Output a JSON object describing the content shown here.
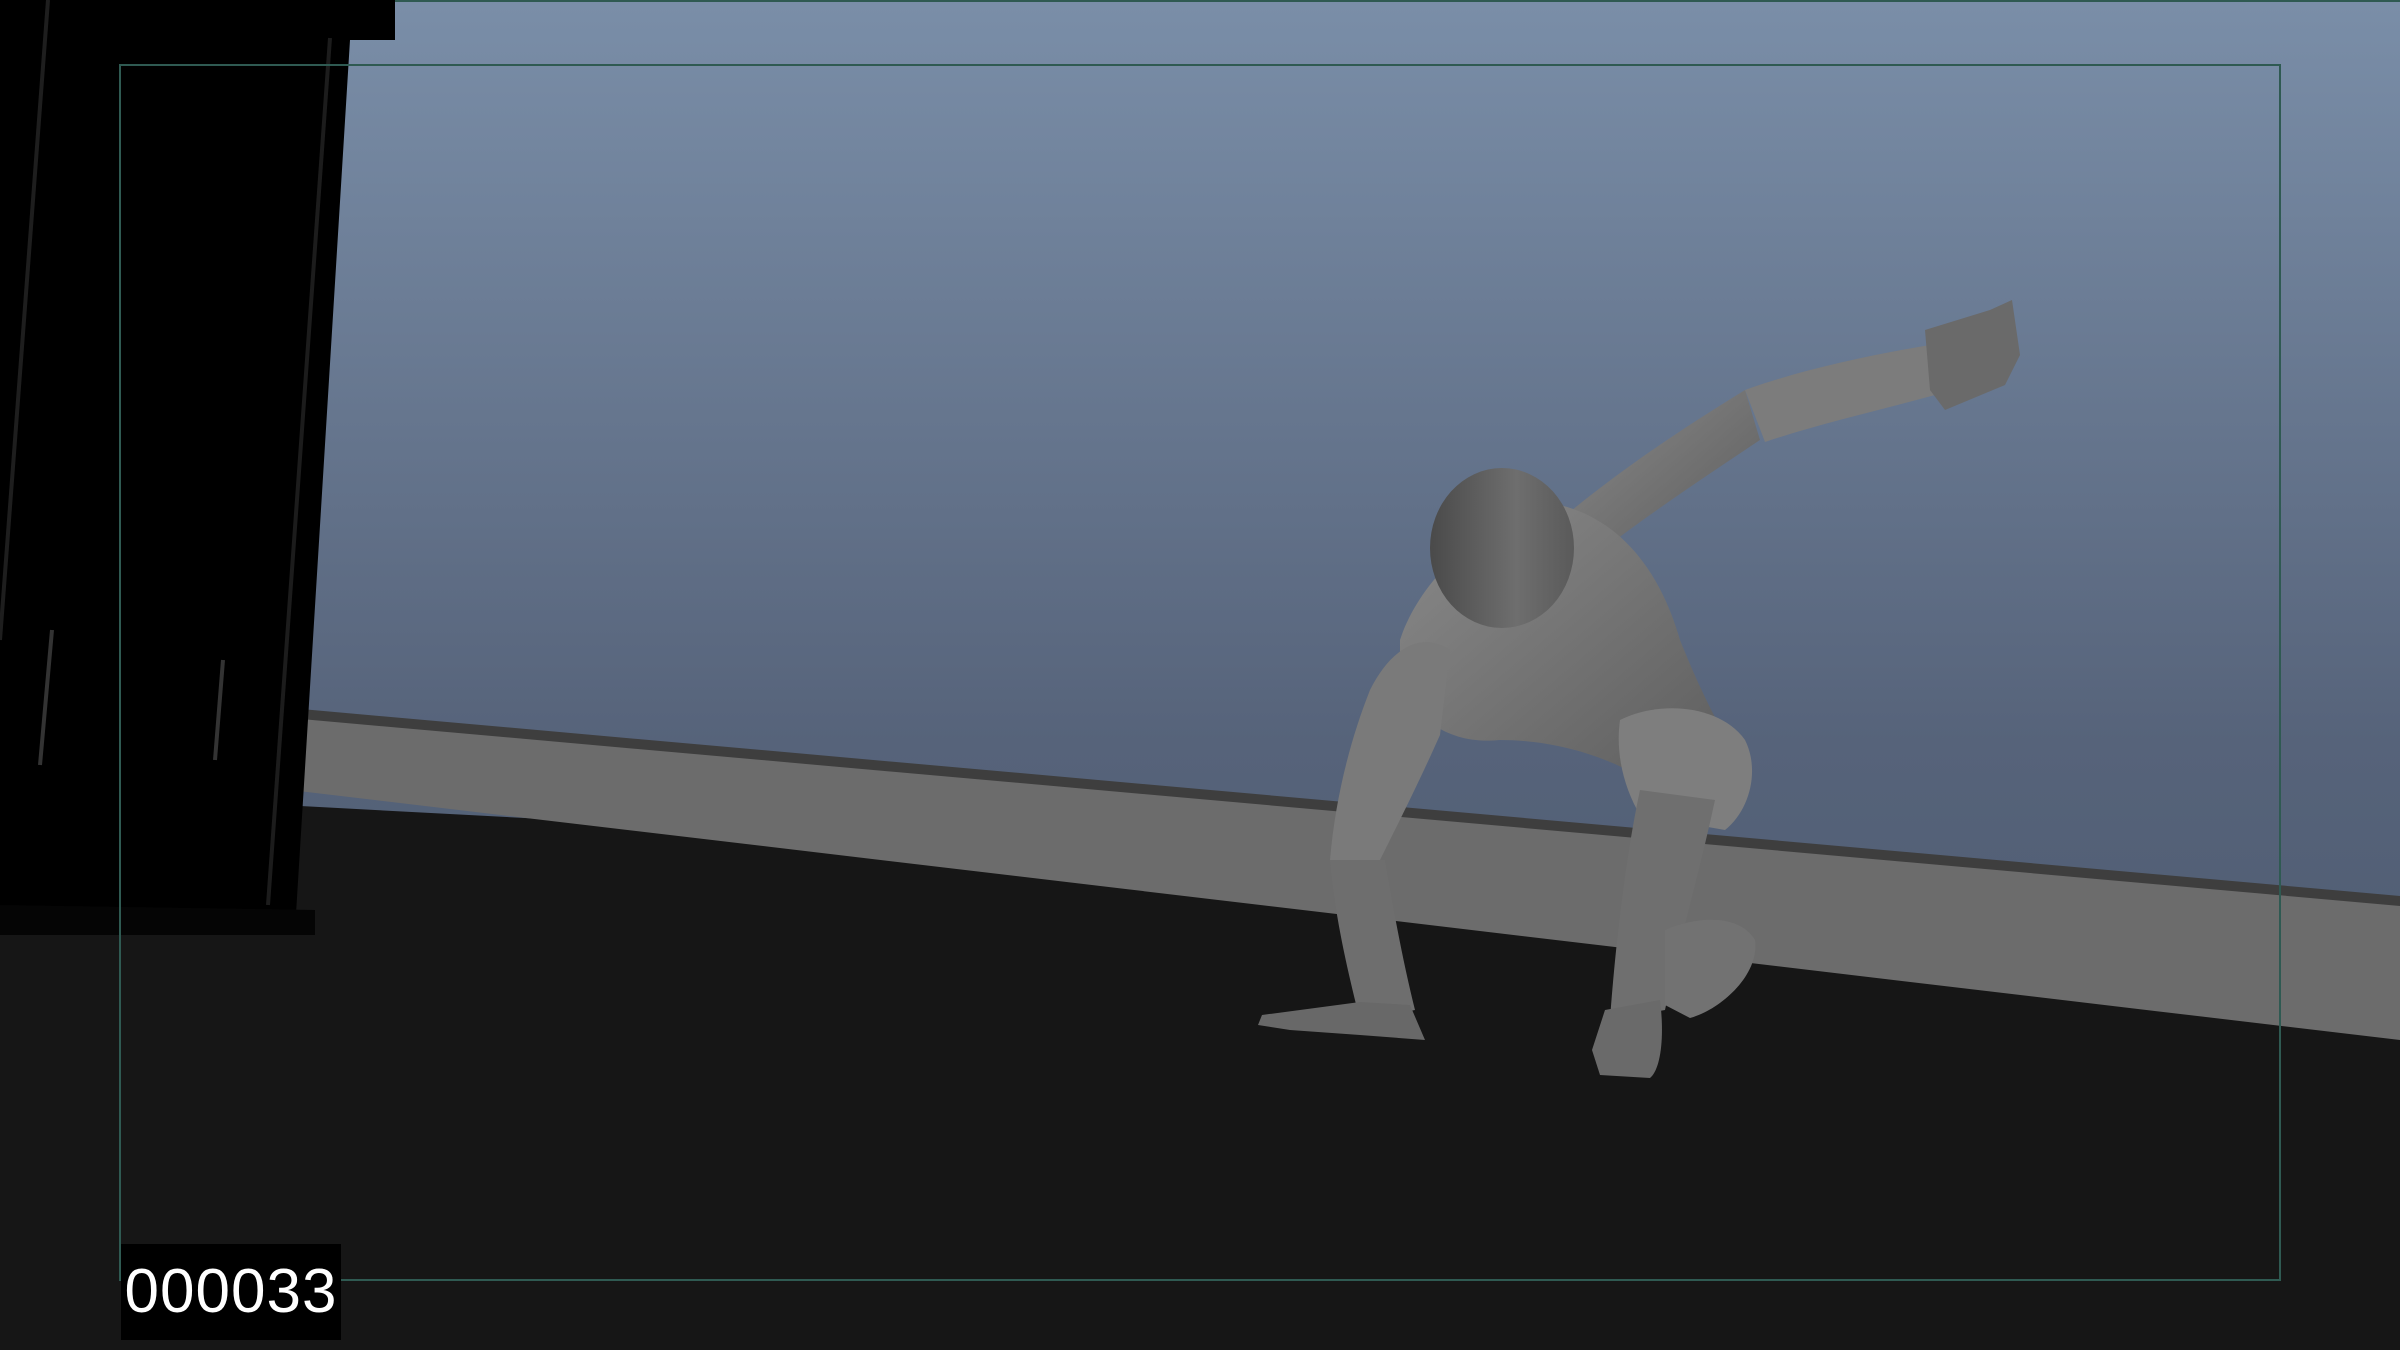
{
  "viewport": {
    "frame_counter": "000033",
    "colors": {
      "sky_top": "#7a8ea8",
      "sky_bottom": "#4a5668",
      "floor": "#161616",
      "baseboard": "#6e6e6e",
      "figure": "#777777",
      "door": "#000000",
      "safe_frame": "#2f5a52"
    }
  }
}
